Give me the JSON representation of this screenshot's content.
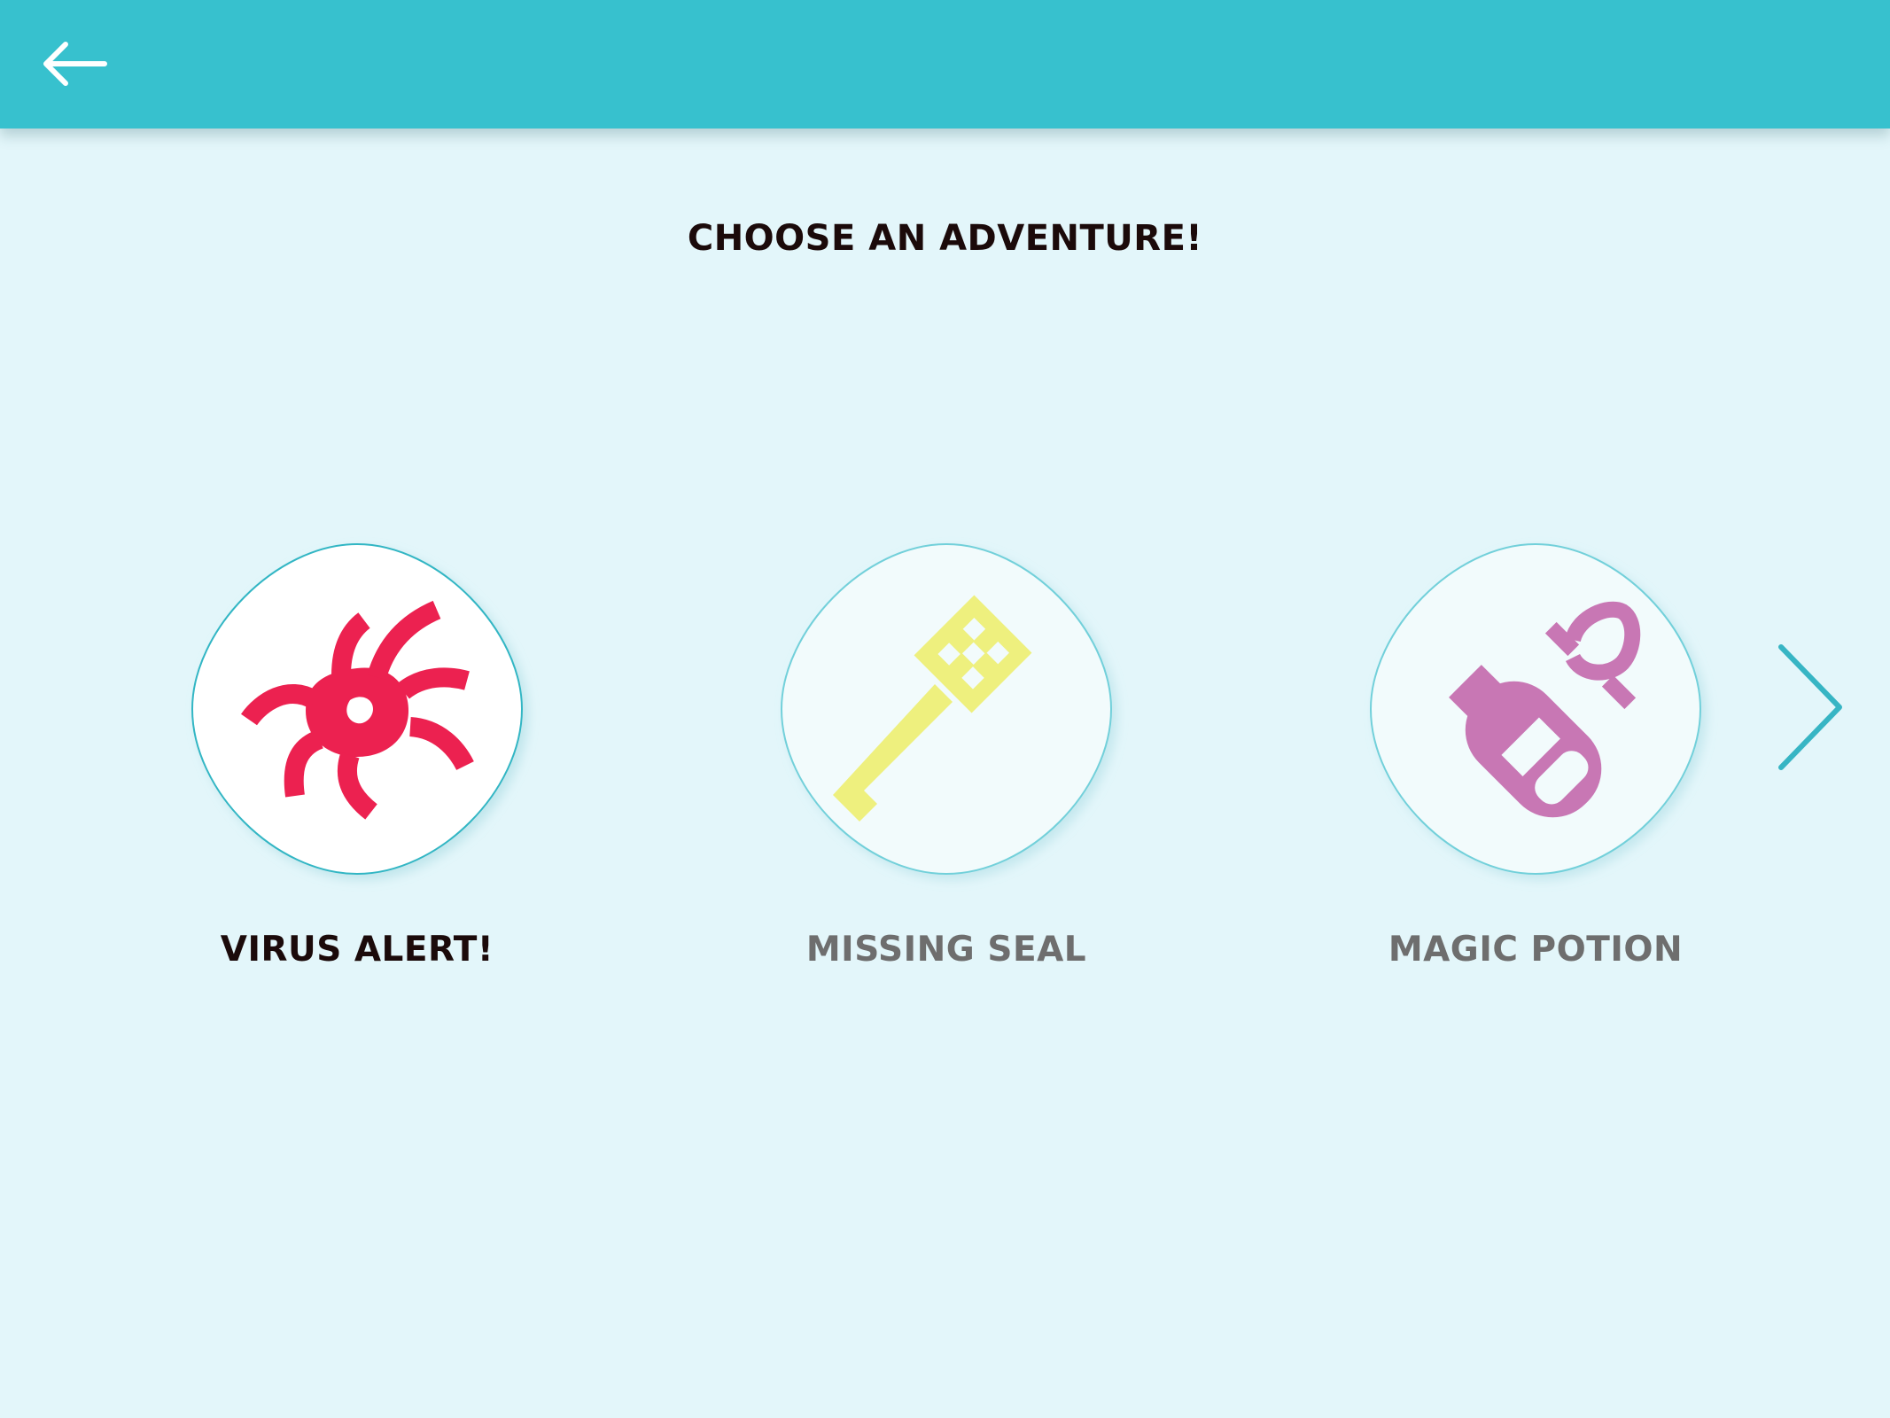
{
  "header": {
    "back_icon": "arrow-left-icon",
    "background_color": "#37c1ce"
  },
  "page": {
    "title": "CHOOSE AN ADVENTURE!",
    "background_color": "#e3f6fa"
  },
  "adventures": [
    {
      "label": "VIRUS ALERT!",
      "icon": "virus-bug-icon",
      "icon_color": "#ec2150",
      "selected": true
    },
    {
      "label": "MISSING SEAL",
      "icon": "key-icon",
      "icon_color": "#eef07e",
      "selected": false
    },
    {
      "label": "MAGIC POTION",
      "icon": "potion-bottle-icon",
      "icon_color": "#c877b4",
      "selected": false
    }
  ],
  "navigation": {
    "next_icon": "chevron-right-icon",
    "accent_color": "#37b5c4"
  }
}
